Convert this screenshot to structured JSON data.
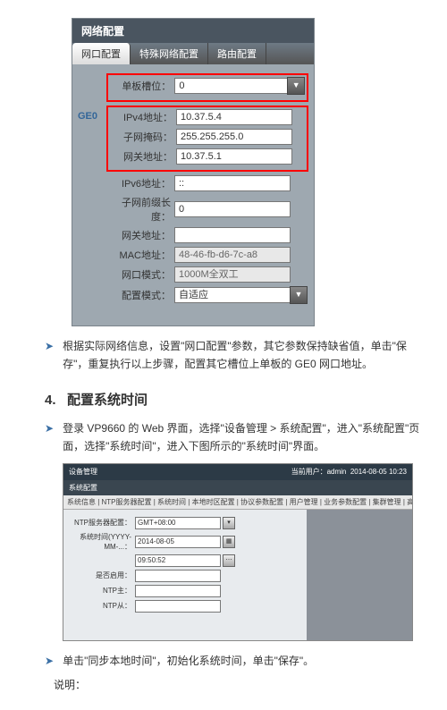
{
  "network": {
    "title": "网络配置",
    "tabs": [
      "网口配置",
      "特殊网络配置",
      "路由配置"
    ],
    "ge_label": "GE0",
    "slot": {
      "label": "单板槽位：",
      "value": "0"
    },
    "fields": [
      {
        "label": "IPv4地址：",
        "value": "10.37.5.4"
      },
      {
        "label": "子网掩码：",
        "value": "255.255.255.0"
      },
      {
        "label": "网关地址：",
        "value": "10.37.5.1"
      }
    ],
    "others": [
      {
        "label": "IPv6地址：",
        "value": "::"
      },
      {
        "label": "子网前缀长度：",
        "value": "0"
      },
      {
        "label": "网关地址：",
        "value": ""
      },
      {
        "label": "MAC地址：",
        "value": "48-46-fb-d6-7c-a8",
        "ro": true
      },
      {
        "label": "网口模式：",
        "value": "1000M全双工",
        "ro": true
      },
      {
        "label": "配置模式：",
        "value": "自适应"
      }
    ]
  },
  "instructions": {
    "b1": "根据实际网络信息，设置\"网口配置\"参数，其它参数保持缺省值，单击\"保存\"，重复执行以上步骤，配置其它槽位上单板的 GE0 网口地址。",
    "head_num": "4.",
    "head_text": "配置系统时间",
    "b2": "登录 VP9660 的 Web 界面，选择\"设备管理 > 系统配置\"，进入\"系统配置\"页面，选择\"系统时间\"，进入下图所示的\"系统时间\"界面。",
    "b3": "单击\"同步本地时间\"，初始化系统时间，单击\"保存\"。",
    "note": "说明："
  },
  "sysconf": {
    "top_left": "设备管理",
    "top_right_user": "当前用户：admin",
    "date": "2014-08-05 10:23",
    "side": "系统配置",
    "tabs_text": "系统信息 | NTP服务器配置 | 系统时间 | 本地时区配置 | 协议参数配置 | 用户管理 | 业务参数配置 | 集群管理 | 高级配置",
    "rows": [
      {
        "label": "NTP服务器配置：",
        "value": "GMT+08:00"
      },
      {
        "label": "系统时间(YYYY-MM-...：",
        "value": "2014-08-05"
      },
      {
        "label": "",
        "value": "09:50:52",
        "btn": "⋯"
      },
      {
        "label": "是否启用：",
        "value": ""
      },
      {
        "label": "NTP主：",
        "value": ""
      },
      {
        "label": "NTP从：",
        "value": ""
      }
    ]
  }
}
